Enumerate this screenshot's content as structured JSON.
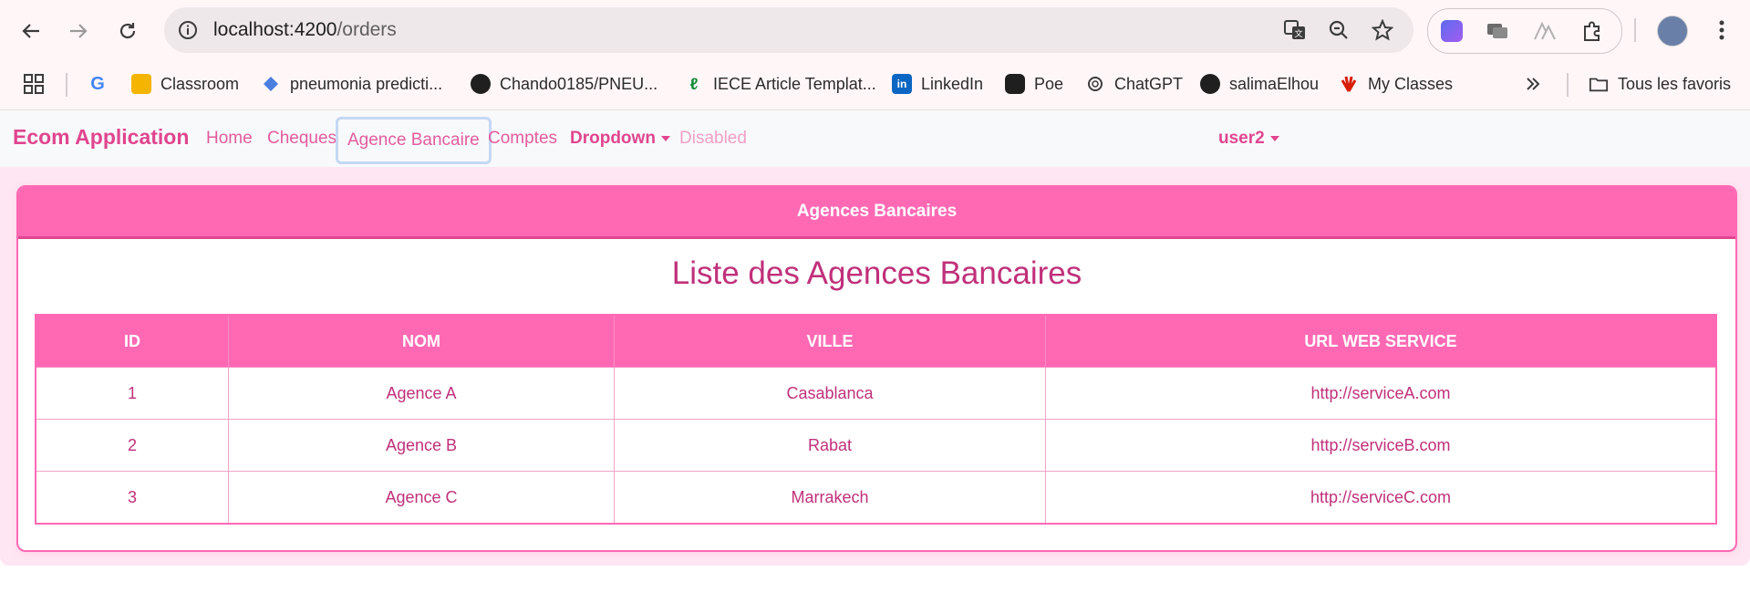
{
  "browser": {
    "url_host": "localhost:4200",
    "url_path": "/orders",
    "bookmarks": [
      {
        "label": "Classroom",
        "icon": "google-classroom-icon"
      },
      {
        "label": "pneumonia predicti...",
        "icon": "diamond-icon"
      },
      {
        "label": "Chando0185/PNEU...",
        "icon": "github-icon"
      },
      {
        "label": "IECE Article Templat...",
        "icon": "overleaf-icon"
      },
      {
        "label": "LinkedIn",
        "icon": "linkedin-icon"
      },
      {
        "label": "Poe",
        "icon": "poe-icon"
      },
      {
        "label": "ChatGPT",
        "icon": "chatgpt-icon"
      },
      {
        "label": "salimaElhou",
        "icon": "github-icon"
      },
      {
        "label": "My Classes",
        "icon": "huawei-icon"
      }
    ],
    "all_bookmarks_label": "Tous les favoris"
  },
  "app": {
    "brand": "Ecom Application",
    "nav": {
      "home": "Home",
      "cheques": "Cheques",
      "agence": "Agence Bancaire",
      "comptes": "Comptes",
      "dropdown": "Dropdown",
      "disabled": "Disabled",
      "user": "user2"
    },
    "accent": "#ff69b4"
  },
  "card": {
    "header": "Agences Bancaires",
    "title": "Liste des Agences Bancaires",
    "columns": [
      "ID",
      "NOM",
      "VILLE",
      "URL WEB SERVICE"
    ],
    "rows": [
      [
        "1",
        "Agence A",
        "Casablanca",
        "http://serviceA.com"
      ],
      [
        "2",
        "Agence B",
        "Rabat",
        "http://serviceB.com"
      ],
      [
        "3",
        "Agence C",
        "Marrakech",
        "http://serviceC.com"
      ]
    ]
  }
}
